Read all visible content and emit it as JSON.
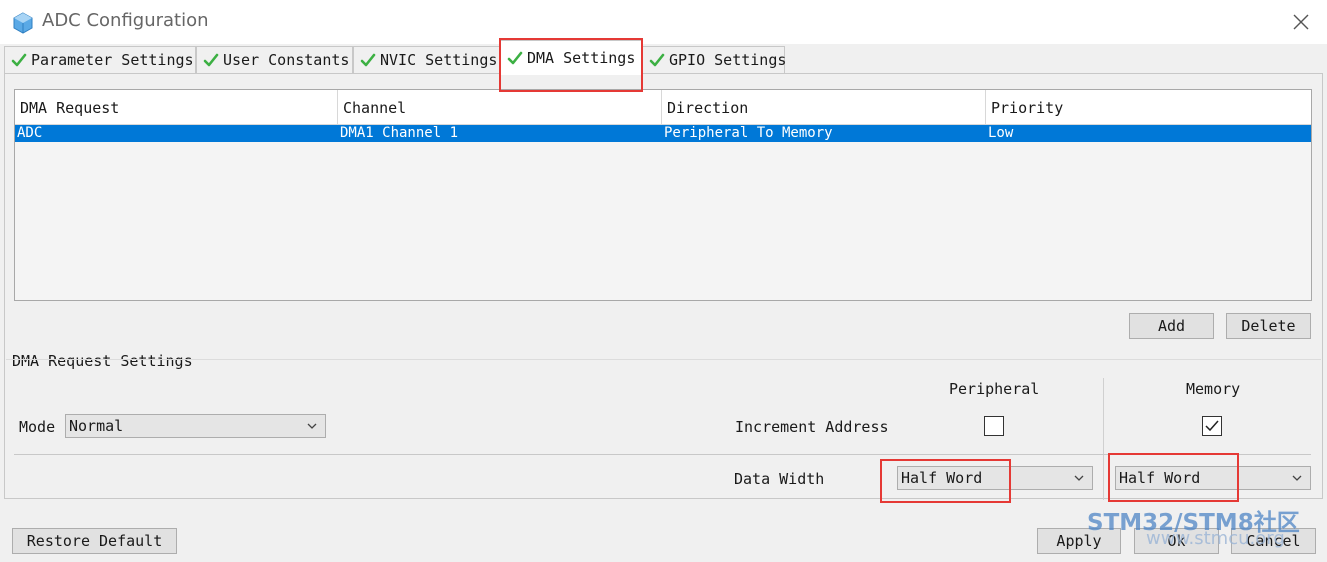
{
  "window": {
    "title": "ADC Configuration"
  },
  "tabs": [
    {
      "label": "Parameter Settings"
    },
    {
      "label": "User Constants"
    },
    {
      "label": "NVIC Settings"
    },
    {
      "label": "DMA Settings"
    },
    {
      "label": "GPIO Settings"
    }
  ],
  "table": {
    "columns": [
      "DMA Request",
      "Channel",
      "Direction",
      "Priority"
    ],
    "rows": [
      {
        "request": "ADC",
        "channel": "DMA1 Channel 1",
        "direction": "Peripheral To Memory",
        "priority": "Low"
      }
    ]
  },
  "buttons": {
    "add": "Add",
    "delete": "Delete",
    "restore": "Restore Default",
    "apply": "Apply",
    "ok": "Ok",
    "cancel": "Cancel"
  },
  "settings": {
    "section_title": "DMA Request Settings",
    "peripheral_header": "Peripheral",
    "memory_header": "Memory",
    "mode_label": "Mode",
    "mode_value": "Normal",
    "increment_label": "Increment Address",
    "peripheral_increment": false,
    "memory_increment": true,
    "data_width_label": "Data Width",
    "peripheral_width": "Half Word",
    "memory_width": "Half Word"
  },
  "watermark": {
    "text": "STM32/STM8社区",
    "url": "www.stmcu.org"
  },
  "colors": {
    "selection": "#0078d7",
    "check_green": "#3cb043",
    "highlight_red": "#e53935"
  }
}
